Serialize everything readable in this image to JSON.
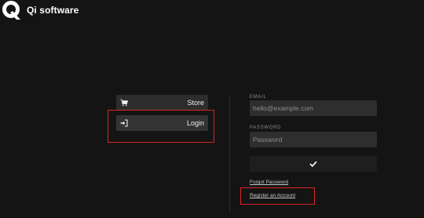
{
  "brand": {
    "name": "Qi software",
    "logo_icon": "qi-logo-icon"
  },
  "menu": {
    "items": [
      {
        "label": "Store",
        "icon": "cart-icon"
      },
      {
        "label": "Login",
        "icon": "sign-in-icon"
      }
    ]
  },
  "form": {
    "email_label": "EMAIL",
    "email_placeholder": "hello@example.com",
    "password_label": "PASSWORD",
    "password_placeholder": "Password",
    "submit_icon": "checkmark-icon",
    "forgot_label": "Forgot Password",
    "register_label": "Register an Account"
  },
  "highlights": {
    "color": "#d8262a",
    "targets": [
      "menu-item-login",
      "register-link"
    ]
  },
  "colors": {
    "background": "#141414",
    "menu_bg": "#2d2d2d",
    "input_bg": "#2e2e2e"
  }
}
